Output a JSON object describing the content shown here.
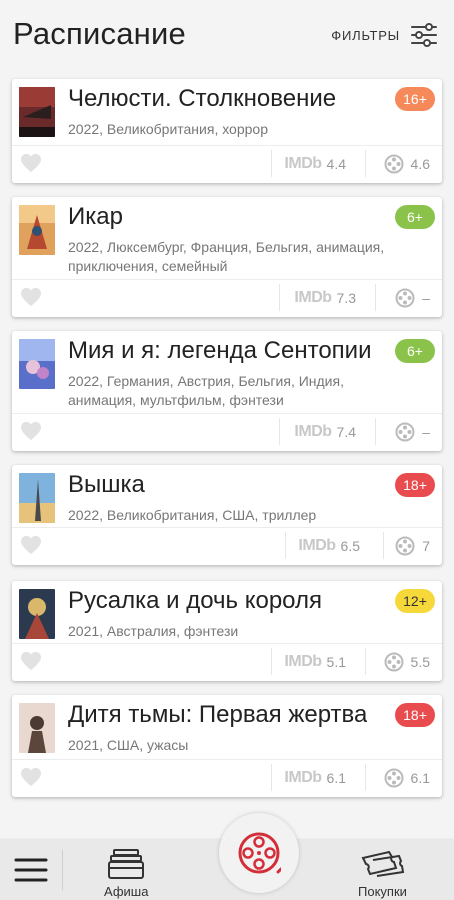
{
  "header": {
    "title": "Расписание",
    "filters_label": "ФИЛЬТРЫ"
  },
  "movies": [
    {
      "title": "Челюсти. Столкновение",
      "meta": "2022, Великобритания, хоррор",
      "age": "16+",
      "age_color": "#f5895a",
      "imdb": "4.4",
      "rating": "4.6"
    },
    {
      "title": "Икар",
      "meta": "2022, Люксембург, Франция, Бельгия, анимация, приключения, семейный",
      "age": "6+",
      "age_color": "#8bc34a",
      "imdb": "7.3",
      "rating": "–"
    },
    {
      "title": "Мия и я: легенда Сентопии",
      "meta": "2022, Германия, Австрия, Бельгия, Индия, анимация, мультфильм, фэнтези",
      "age": "6+",
      "age_color": "#8bc34a",
      "imdb": "7.4",
      "rating": "–"
    },
    {
      "title": "Вышка",
      "meta": "2022, Великобритания, США, триллер",
      "age": "18+",
      "age_color": "#e84c4f",
      "imdb": "6.5",
      "rating": "7"
    },
    {
      "title": "Русалка и дочь короля",
      "meta": "2021, Австралия, фэнтези",
      "age": "12+",
      "age_color": "#f7d83b",
      "imdb": "5.1",
      "rating": "5.5"
    },
    {
      "title": "Дитя тьмы: Первая жертва",
      "meta": "2021, США, ужасы",
      "age": "18+",
      "age_color": "#e84c4f",
      "imdb": "6.1",
      "rating": "6.1"
    }
  ],
  "imdb_label": "IMDb",
  "nav": {
    "afisha": "Афиша",
    "purchases": "Покупки"
  },
  "colors": {
    "accent": "#d32f3a",
    "background": "#f4f4f4"
  }
}
